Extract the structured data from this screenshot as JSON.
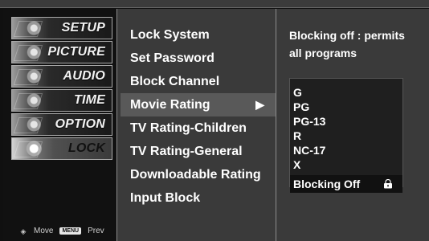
{
  "left_menu": {
    "categories": [
      {
        "label": "SETUP",
        "icon": "setup-icon"
      },
      {
        "label": "PICTURE",
        "icon": "picture-icon"
      },
      {
        "label": "AUDIO",
        "icon": "audio-icon"
      },
      {
        "label": "TIME",
        "icon": "time-icon"
      },
      {
        "label": "OPTION",
        "icon": "option-icon"
      },
      {
        "label": "LOCK",
        "icon": "lock-category-icon",
        "selected": true
      }
    ]
  },
  "footer": {
    "move_icon": "◈",
    "move_label": "Move",
    "menu_badge": "MENU",
    "prev_label": "Prev"
  },
  "options": [
    {
      "label": "Lock System"
    },
    {
      "label": "Set Password"
    },
    {
      "label": "Block Channel"
    },
    {
      "label": "Movie Rating",
      "selected": true,
      "arrow": "▶"
    },
    {
      "label": "TV Rating-Children"
    },
    {
      "label": "TV Rating-General"
    },
    {
      "label": "Downloadable Rating"
    },
    {
      "label": "Input Block"
    }
  ],
  "details": {
    "description": "Blocking off : permits all programs",
    "ratings": [
      {
        "label": "G"
      },
      {
        "label": "PG"
      },
      {
        "label": "PG-13"
      },
      {
        "label": "R"
      },
      {
        "label": "NC-17"
      },
      {
        "label": "X"
      },
      {
        "label": "Blocking Off",
        "highlight": true,
        "icon": "lock-icon"
      }
    ]
  }
}
